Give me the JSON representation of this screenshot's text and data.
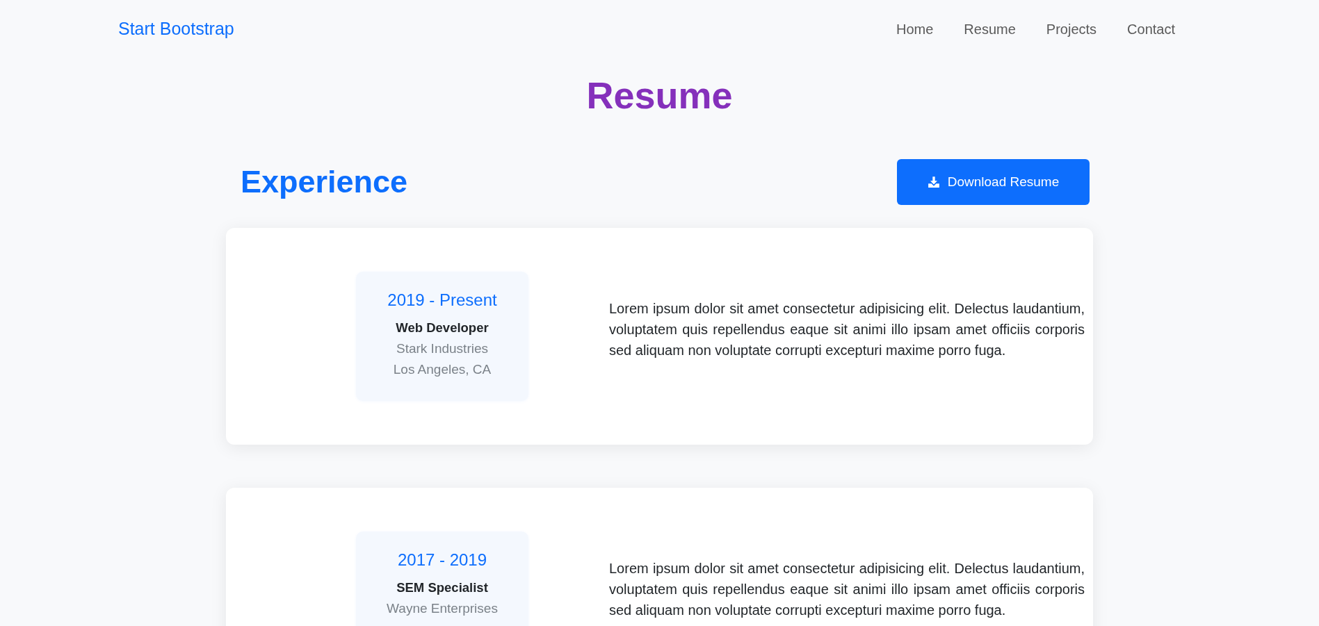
{
  "navbar": {
    "brand": "Start Bootstrap",
    "links": [
      "Home",
      "Resume",
      "Projects",
      "Contact"
    ]
  },
  "page_title": "Resume",
  "section": {
    "heading": "Experience",
    "download_button": "Download Resume"
  },
  "experience": [
    {
      "period": "2019 - Present",
      "role": "Web Developer",
      "company": "Stark Industries",
      "location": "Los Angeles, CA",
      "description": "Lorem ipsum dolor sit amet consectetur adipisicing elit. Delectus laudantium, voluptatem quis repellendus eaque sit animi illo ipsam amet officiis corporis sed aliquam non voluptate corrupti excepturi maxime porro fuga."
    },
    {
      "period": "2017 - 2019",
      "role": "SEM Specialist",
      "company": "Wayne Enterprises",
      "description": "Lorem ipsum dolor sit amet consectetur adipisicing elit. Delectus laudantium, voluptatem quis repellendus eaque sit animi illo ipsam amet officiis corporis sed aliquam non voluptate corrupti excepturi maxime porro fuga."
    }
  ]
}
